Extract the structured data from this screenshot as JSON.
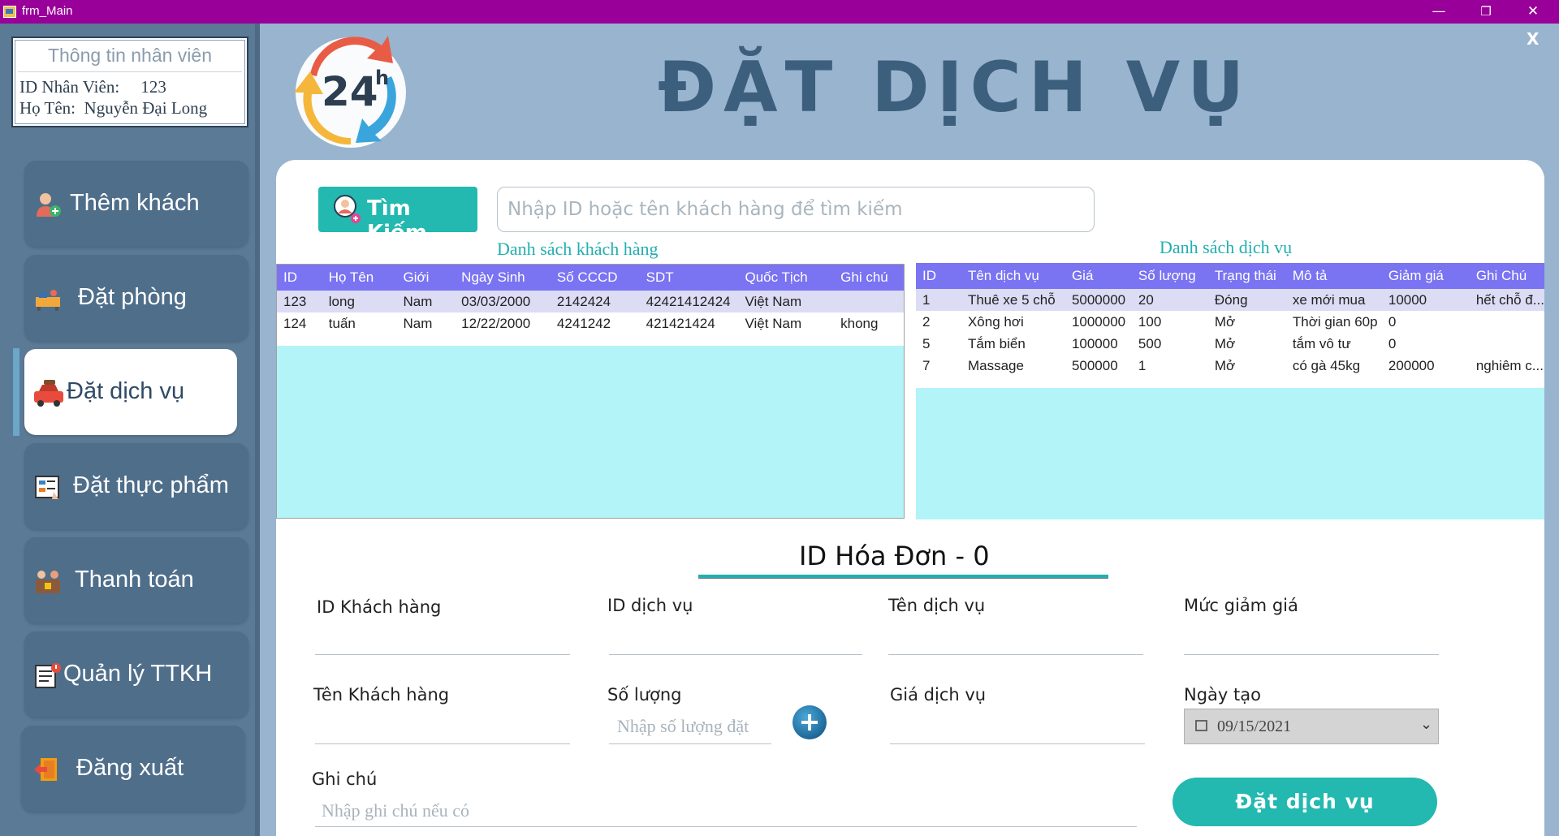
{
  "window": {
    "title": "frm_Main",
    "minimize": "—",
    "restore": "❐",
    "close": "✕"
  },
  "employee": {
    "header": "Thông tin nhân viên",
    "id_label": "ID Nhân Viên:",
    "id_value": "123",
    "name_label": "Họ Tên:",
    "name_value": "Nguyễn Đại Long"
  },
  "menu": [
    {
      "label": "Thêm khách",
      "icon": "add-customer-icon"
    },
    {
      "label": "Đặt phòng",
      "icon": "room-booking-icon"
    },
    {
      "label": "Đặt dịch vụ",
      "icon": "car-service-icon",
      "active": true
    },
    {
      "label": "Đặt thực phẩm",
      "icon": "food-order-icon"
    },
    {
      "label": "Thanh toán",
      "icon": "payment-icon"
    },
    {
      "label": "Quản lý TTKH",
      "icon": "customer-management-icon"
    },
    {
      "label": "Đăng xuất",
      "icon": "logout-icon"
    }
  ],
  "header": {
    "title": "ĐẶT DỊCH VỤ",
    "close": "X",
    "logo_text": "24",
    "logo_sup": "h"
  },
  "search": {
    "button_label": "Tìm Kiếm",
    "placeholder": "Nhập ID hoặc tên khách hàng để tìm kiếm"
  },
  "customers": {
    "title": "Danh sách khách hàng",
    "columns": [
      "ID",
      "Họ Tên",
      "Giới",
      "Ngày Sinh",
      "Số CCCD",
      "SDT",
      "Quốc Tịch",
      "Ghi chú"
    ],
    "rows": [
      [
        "123",
        "long",
        "Nam",
        "03/03/2000",
        "2142424",
        "42421412424",
        "Việt Nam",
        ""
      ],
      [
        "124",
        "tuấn",
        "Nam",
        "12/22/2000",
        "4241242",
        "421421424",
        "Việt Nam",
        "khong"
      ]
    ]
  },
  "services": {
    "title": "Danh sách dịch vụ",
    "columns": [
      "ID",
      "Tên dịch vụ",
      "Giá",
      "Số lượng",
      "Trạng thái",
      "Mô tả",
      "Giảm giá",
      "Ghi Chú"
    ],
    "rows": [
      [
        "1",
        "Thuê xe 5 chỗ",
        "5000000",
        "20",
        "Đóng",
        "xe mới mua",
        "10000",
        "hết chỗ đ..."
      ],
      [
        "2",
        "Xông hơi",
        "1000000",
        "100",
        "Mở",
        "Thời gian 60p",
        "0",
        ""
      ],
      [
        "5",
        "Tắm biển",
        "100000",
        "500",
        "Mở",
        "tắm vô tư",
        "0",
        ""
      ],
      [
        "7",
        "Massage",
        "500000",
        "1",
        "Mở",
        "có gà 45kg",
        "200000",
        "nghiêm c..."
      ]
    ]
  },
  "invoice": {
    "title": "ID Hóa Đơn -  0",
    "customer_id_label": "ID Khách hàng",
    "service_id_label": "ID dịch vụ",
    "service_name_label": "Tên dịch vụ",
    "discount_label": "Mức giảm giá",
    "customer_name_label": "Tên Khách hàng",
    "quantity_label": "Số lượng",
    "quantity_placeholder": "Nhập số lượng đặt",
    "price_label": "Giá dịch vụ",
    "date_label": "Ngày tạo",
    "date_value": "09/15/2021",
    "note_label": "Ghi chú",
    "note_placeholder": "Nhập ghi chú nếu có",
    "submit_label": "Đặt dịch vụ"
  },
  "colors": {
    "accent": "#23b8b0",
    "header_grid": "#7a73f2",
    "sidebar": "#5a7a96",
    "titlebar": "#990099"
  }
}
